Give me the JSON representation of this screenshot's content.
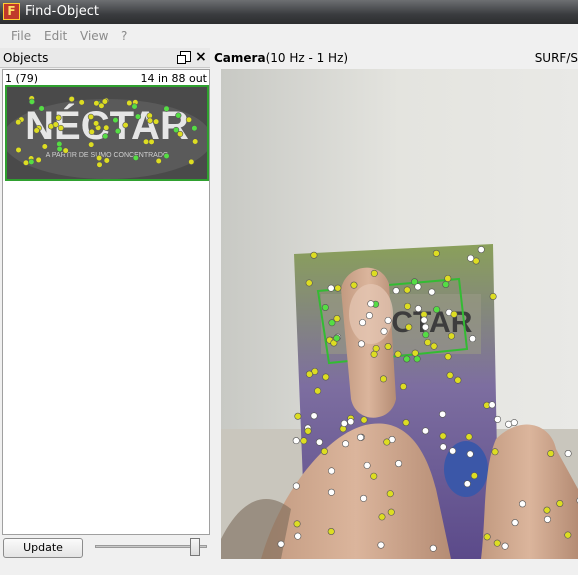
{
  "window": {
    "title": "Find-Object",
    "icon": "app-logo-icon"
  },
  "menu": {
    "items": [
      "File",
      "Edit",
      "View",
      "?"
    ]
  },
  "objects_dock": {
    "title": "Objects",
    "float_icon": "dock-float-icon",
    "close_icon": "close-icon",
    "object": {
      "id_label": "1 (79)",
      "stats": "14 in 88 out",
      "thumbnail_text": "NÉCTAR",
      "thumbnail_subtext": "A PARTIR DE SUMO CONCENTRADO"
    },
    "update_button": "Update objects",
    "slider_value": 0.9
  },
  "camera": {
    "title": "Camera",
    "rate": "(10 Hz - 1 Hz)",
    "method": "SURF/S",
    "box_text": "NECTAR",
    "colors": {
      "inlier": "#55dd44",
      "outlier": "#dddd22",
      "unmatched": "#ffffff",
      "homography": "#33bb33"
    }
  }
}
